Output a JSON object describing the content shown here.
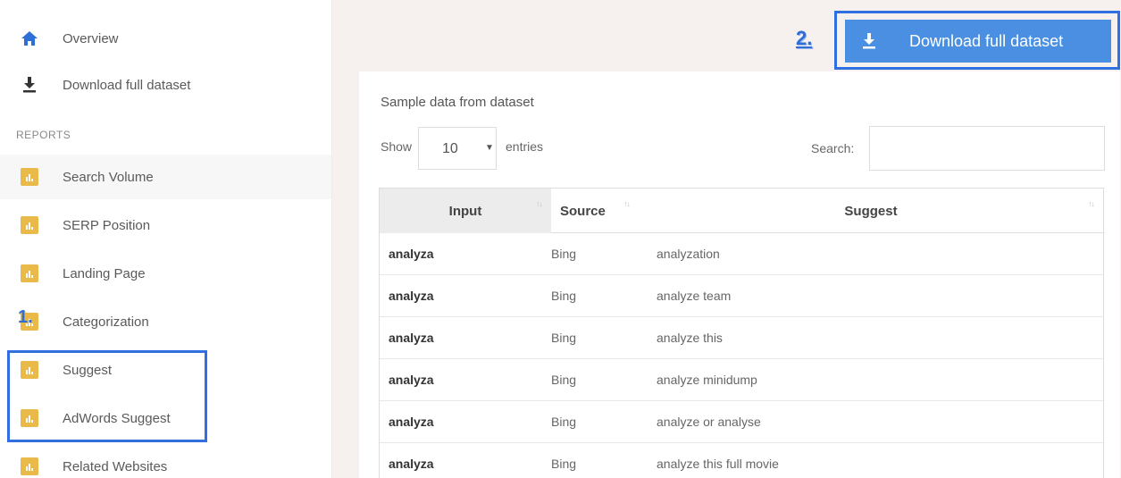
{
  "sidebar": {
    "top_items": [
      {
        "label": "Overview",
        "icon": "home-icon"
      },
      {
        "label": "Download full dataset",
        "icon": "download-icon"
      }
    ],
    "section_heading": "REPORTS",
    "report_items": [
      {
        "label": "Search Volume",
        "icon": "bar-chart-icon"
      },
      {
        "label": "SERP Position",
        "icon": "bar-chart-icon"
      },
      {
        "label": "Landing Page",
        "icon": "bar-chart-icon"
      },
      {
        "label": "Categorization",
        "icon": "bar-chart-icon"
      },
      {
        "label": "Suggest",
        "icon": "bar-chart-icon"
      },
      {
        "label": "AdWords Suggest",
        "icon": "bar-chart-icon"
      },
      {
        "label": "Related Websites",
        "icon": "bar-chart-icon"
      }
    ]
  },
  "annotations": {
    "step1": "1.",
    "step2": "2."
  },
  "main": {
    "download_button": {
      "label": "Download full dataset",
      "icon": "download-icon"
    },
    "card_title": "Sample data from dataset",
    "length_control": {
      "show_label": "Show",
      "value": "10",
      "entries_label": "entries"
    },
    "search": {
      "label": "Search:",
      "value": ""
    },
    "table": {
      "headers": [
        "Input",
        "Source",
        "Suggest"
      ],
      "rows": [
        [
          "analyza",
          "Bing",
          "analyzation"
        ],
        [
          "analyza",
          "Bing",
          "analyze team"
        ],
        [
          "analyza",
          "Bing",
          "analyze this"
        ],
        [
          "analyza",
          "Bing",
          "analyze minidump"
        ],
        [
          "analyza",
          "Bing",
          "analyze or analyse"
        ],
        [
          "analyza",
          "Bing",
          "analyze this full movie"
        ]
      ]
    }
  },
  "colors": {
    "accent_blue": "#4a8fe2",
    "highlight_border": "#2f6fe0",
    "report_icon": "#e9b949",
    "main_background": "#f6f0ee"
  }
}
